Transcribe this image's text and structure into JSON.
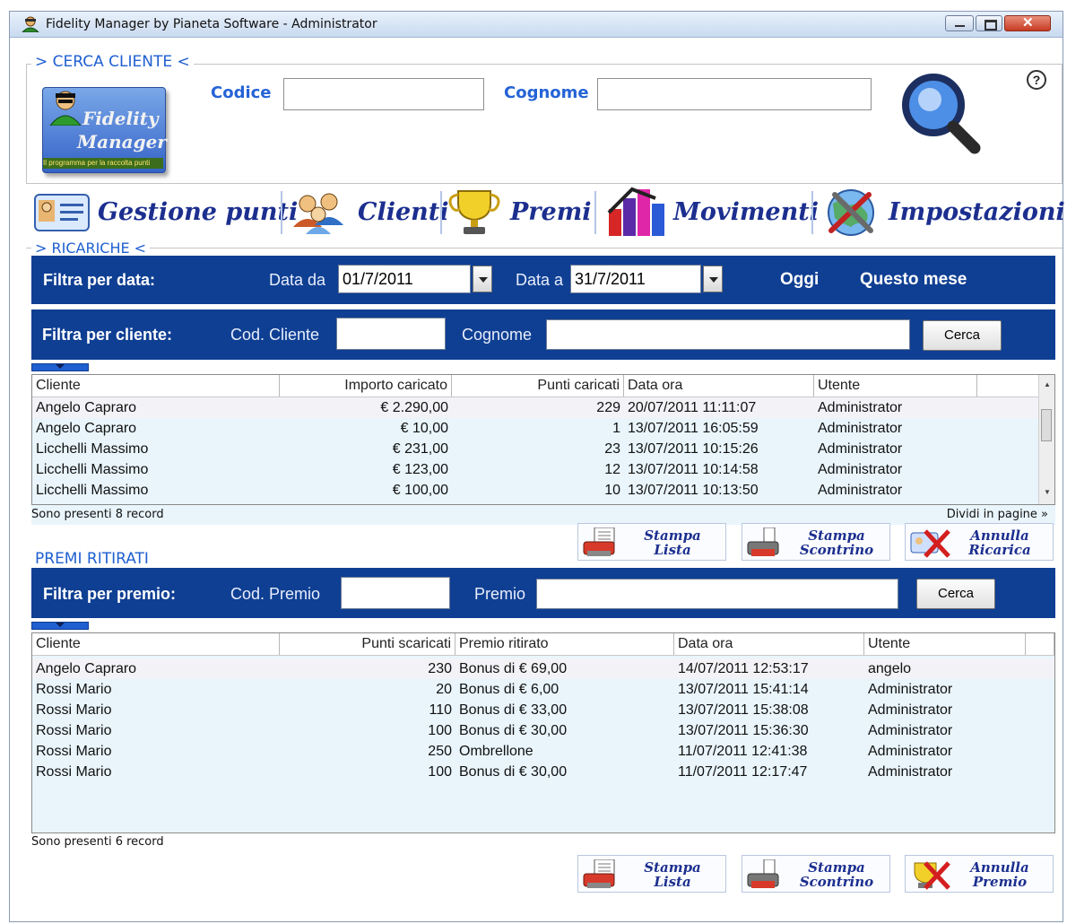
{
  "window": {
    "title": "Fidelity Manager by Pianeta Software - Administrator"
  },
  "search": {
    "legend": "> CERCA CLIENTE <",
    "codice_label": "Codice",
    "cognome_label": "Cognome",
    "codice_value": "",
    "cognome_value": "",
    "logo_line1": "Fidelity",
    "logo_line2": "Manager",
    "logo_tagline": "Il programma per la raccolta punti"
  },
  "nav": [
    {
      "label": "Gestione punti",
      "icon": "card-icon"
    },
    {
      "label": "Clienti",
      "icon": "users-icon"
    },
    {
      "label": "Premi",
      "icon": "trophy-icon"
    },
    {
      "label": "Movimenti",
      "icon": "bar-chart-icon"
    },
    {
      "label": "Impostazioni",
      "icon": "settings-globe-icon"
    }
  ],
  "ricariche": {
    "legend": "> RICARICHE <",
    "filter_date_label": "Filtra per data:",
    "data_da_label": "Data da",
    "data_da_value": "01/7/2011",
    "data_a_label": "Data a",
    "data_a_value": "31/7/2011",
    "oggi": "Oggi",
    "questo_mese": "Questo mese",
    "filter_client_label": "Filtra per cliente:",
    "cod_cliente_label": "Cod. Cliente",
    "cod_cliente_value": "",
    "cognome_label": "Cognome",
    "cognome_value": "",
    "cerca": "Cerca",
    "columns": [
      "Cliente",
      "Importo caricato",
      "Punti caricati",
      "Data ora",
      "Utente"
    ],
    "rows": [
      [
        "Angelo Capraro",
        "€ 2.290,00",
        "229",
        "20/07/2011 11:11:07",
        "Administrator"
      ],
      [
        "Angelo Capraro",
        "€ 10,00",
        "1",
        "13/07/2011 16:05:59",
        "Administrator"
      ],
      [
        "Licchelli Massimo",
        "€ 231,00",
        "23",
        "13/07/2011 10:15:26",
        "Administrator"
      ],
      [
        "Licchelli Massimo",
        "€ 123,00",
        "12",
        "13/07/2011 10:14:58",
        "Administrator"
      ],
      [
        "Licchelli Massimo",
        "€ 100,00",
        "10",
        "13/07/2011 10:13:50",
        "Administrator"
      ]
    ],
    "records": "Sono presenti 8 record",
    "dividi": "Dividi in pagine »",
    "btn_stampa_lista": "Stampa\nLista",
    "btn_stampa_scontrino": "Stampa\nScontrino",
    "btn_annulla": "Annulla\nRicarica"
  },
  "premi": {
    "title": "PREMI RITIRATI",
    "filter_label": "Filtra per premio:",
    "cod_premio_label": "Cod. Premio",
    "cod_premio_value": "",
    "premio_label": "Premio",
    "premio_value": "",
    "cerca": "Cerca",
    "columns": [
      "Cliente",
      "Punti scaricati",
      "Premio ritirato",
      "Data ora",
      "Utente"
    ],
    "rows": [
      [
        "Angelo Capraro",
        "230",
        "Bonus di € 69,00",
        "14/07/2011 12:53:17",
        "angelo"
      ],
      [
        "Rossi Mario",
        "20",
        "Bonus di € 6,00",
        "13/07/2011 15:41:14",
        "Administrator"
      ],
      [
        "Rossi Mario",
        "110",
        "Bonus di € 33,00",
        "13/07/2011 15:38:08",
        "Administrator"
      ],
      [
        "Rossi Mario",
        "100",
        "Bonus di € 30,00",
        "13/07/2011 15:36:30",
        "Administrator"
      ],
      [
        "Rossi Mario",
        "250",
        "Ombrellone",
        "11/07/2011 12:41:38",
        "Administrator"
      ],
      [
        "Rossi Mario",
        "100",
        "Bonus di € 30,00",
        "11/07/2011 12:17:47",
        "Administrator"
      ]
    ],
    "records": "Sono presenti 6 record",
    "btn_stampa_lista": "Stampa\nLista",
    "btn_stampa_scontrino": "Stampa\nScontrino",
    "btn_annulla": "Annulla\nPremio"
  },
  "colors": {
    "accent": "#1f5fd0",
    "bar": "#0f3f93",
    "grid_bg": "#e9f5fb",
    "nav_text": "#1c2f8f"
  }
}
